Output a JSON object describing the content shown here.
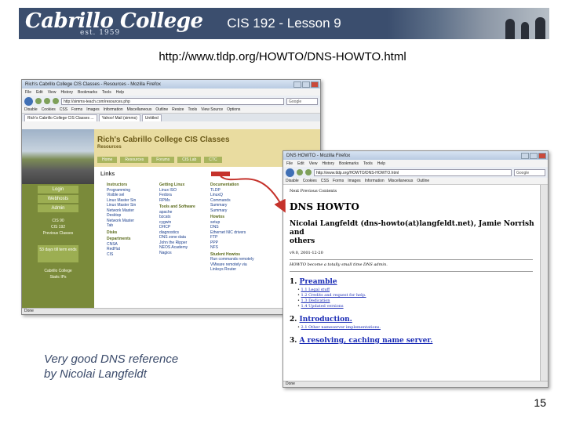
{
  "slide": {
    "title": "CIS 192 - Lesson 9",
    "url": "http://www.tldp.org/HOWTO/DNS-HOWTO.html",
    "caption_line1": "Very good DNS reference",
    "caption_line2": "by Nicolai Langfeldt",
    "page_number": "15"
  },
  "banner": {
    "logo": "Cabrillo College",
    "est": "est. 1959"
  },
  "browser1": {
    "title": "Rich's Cabrillo College CIS Classes - Resources - Mozilla Firefox",
    "menu": [
      "File",
      "Edit",
      "View",
      "History",
      "Bookmarks",
      "Tools",
      "Help"
    ],
    "address": "http://simms-teach.com/resources.php",
    "search": "Google",
    "bookmarks": [
      "Disable",
      "Cookies",
      "CSS",
      "Forms",
      "Images",
      "Information",
      "Miscellaneous",
      "Outline",
      "Resize",
      "Tools",
      "View Source",
      "Options"
    ],
    "tabs": [
      "Rich's Cabrillo College CIS Classes ...",
      "Yahoo! Mail (simms)",
      "Untitled"
    ],
    "status": "Done",
    "page": {
      "header_title": "Rich's Cabrillo College CIS Classes",
      "header_sub": "Resources",
      "header_tabs": [
        "Home",
        "Resources",
        "Forums",
        "CIS Lab",
        "CTC"
      ],
      "sidebar": [
        "Login",
        "Webhosts",
        "Admin"
      ],
      "sidebar_text": [
        "CIS 90",
        "CIS 192",
        "Previous Classes"
      ],
      "sidebar_box": "53 days till term ends",
      "sidebar_footer": [
        "Cabrillo College",
        "Static IPs"
      ],
      "links_heading": "Links",
      "columns": [
        {
          "head": "Instructors",
          "items": [
            "Programming",
            "Visible sel",
            "Linux Master Sin",
            "Linux Master Sin",
            "Network Master",
            "Desktop",
            "Network Master",
            "Tab"
          ]
        },
        {
          "head": "Getting Linux",
          "items": [
            "Linux ISO",
            "Fedora",
            "RPMs",
            "Tools and Software",
            "apache",
            "bzcats",
            "cygwin",
            "DHCP",
            "diagnostics",
            "DNS zone data",
            "John the Ripper",
            "NEOS Academy",
            "Nagios"
          ]
        },
        {
          "head": "Documentation",
          "items": [
            "TLDP",
            "LinuxQ",
            "Commands",
            "Summary",
            "Summary",
            "Howtos",
            "setup",
            "DNS",
            "Ethernet NIC drivers",
            "FTP",
            "PPP",
            "NFS"
          ]
        }
      ],
      "col2_extra_heading": "Disks",
      "col1_extra_heading": "Departments",
      "col1_extra_items": [
        "CNSA",
        "RedHat",
        "CIS"
      ],
      "col3_extra_heading": "Student Howtos",
      "col3_extra_items": [
        "Run commands remotely",
        "VMware remotely via Linksys Router"
      ]
    }
  },
  "browser2": {
    "title": "DNS HOWTO - Mozilla Firefox",
    "menu": [
      "File",
      "Edit",
      "View",
      "History",
      "Bookmarks",
      "Tools",
      "Help"
    ],
    "address": "http://www.tldp.org/HOWTO/DNS-HOWTO.html",
    "search": "Google",
    "bookmarks": [
      "Disable",
      "Cookies",
      "CSS",
      "Forms",
      "Images",
      "Information",
      "Miscellaneous",
      "Outline"
    ],
    "status": "Done",
    "doc": {
      "nav": "Next Previous Contents",
      "h1": "DNS HOWTO",
      "author_line1": "Nicolai Langfeldt (dns-howto(at)langfeldt.net), Jamie Norrish and",
      "author_line2": "others",
      "date": "v9.0, 2001-12-20",
      "abstract": "HOWTO become a totally small time DNS admin.",
      "sec1_num": "1.",
      "sec1": "Preamble",
      "sec1_items": [
        "1.1 Legal stuff",
        "1.2 Credits and request for help.",
        "1.3 Dedication",
        "1.4 Updated versions"
      ],
      "sec2_num": "2.",
      "sec2": "Introduction.",
      "sec2_items": [
        "2.1 Other nameserver implementations."
      ],
      "sec3_num": "3.",
      "sec3": "A resolving, caching name server."
    }
  },
  "colors": {
    "banner": "#3b4e6e",
    "accent_arrow": "#c5322b",
    "link": "#1a2bb5",
    "caption": "#3a4a6a"
  }
}
